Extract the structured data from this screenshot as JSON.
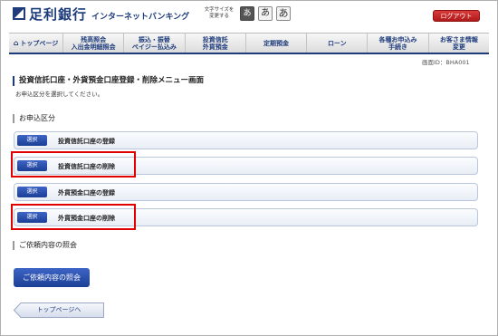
{
  "header": {
    "bank_name": "足利銀行",
    "service_name": "インターネットバンキング",
    "font_size_label": "文字サイズを\n変更する",
    "font_sizes": [
      "あ",
      "あ",
      "あ"
    ],
    "logout_label": "ログアウト"
  },
  "nav": {
    "home_label": "トップページ",
    "items": [
      "残高照会\n入出金明細照会",
      "振込・振替\nペイジー払込み",
      "投資信託\n外貨預金",
      "定期預金",
      "ローン",
      "各種お申込み\n手続き",
      "お客さま情報\n変更"
    ]
  },
  "screen_id": "画面ID：BHA001",
  "page_title": "投資信託口座・外貨預金口座登録・削除メニュー画面",
  "instruction": "お申込区分を選択してください。",
  "section_apply": "お申込区分",
  "rows": [
    {
      "button": "選択",
      "label": "投資信託口座の登録"
    },
    {
      "button": "選択",
      "label": "投資信託口座の削除"
    },
    {
      "button": "選択",
      "label": "外貨預金口座の登録"
    },
    {
      "button": "選択",
      "label": "外貨預金口座の削除"
    }
  ],
  "section_inquiry": "ご依頼内容の照会",
  "inquiry_button": "ご依頼内容の照会",
  "back_button": "トップページへ",
  "colors": {
    "brand": "#1e3c7c",
    "button": "#1c3f96",
    "logout": "#b01a1a",
    "highlight": "#e00000"
  }
}
